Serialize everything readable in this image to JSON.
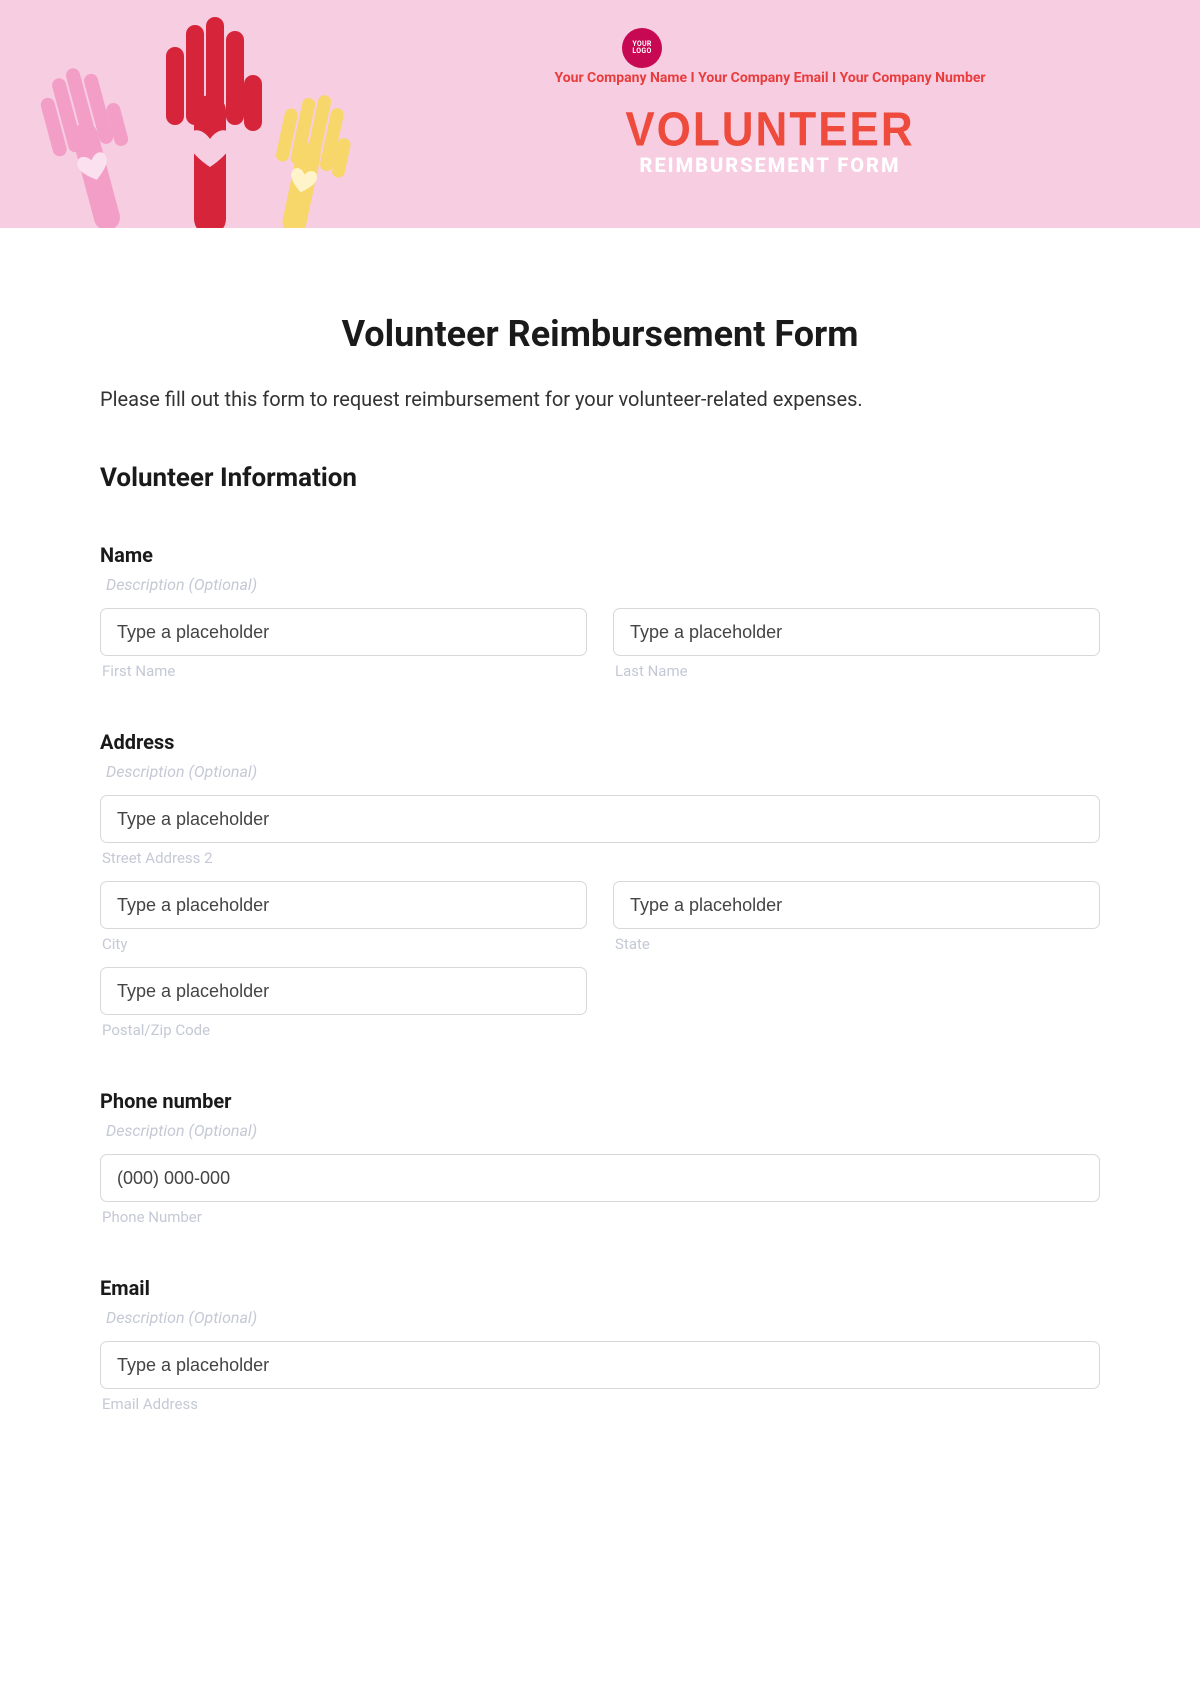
{
  "banner": {
    "logo_text": "YOUR LOGO",
    "company_name": "Your Company Name",
    "company_email": "Your Company Email",
    "company_number": "Your Company Number",
    "sep": "  I  ",
    "title_main": "VOLUNTEER",
    "title_sub": "REIMBURSEMENT FORM"
  },
  "form": {
    "title": "Volunteer Reimbursement Form",
    "intro": "Please fill out this form to request reimbursement for your volunteer-related expenses.",
    "section_volunteer": "Volunteer Information",
    "desc_optional": "Description (Optional)",
    "placeholder_generic": "Type a placeholder",
    "name": {
      "label": "Name",
      "first_sub": "First Name",
      "last_sub": "Last Name"
    },
    "address": {
      "label": "Address",
      "street2_sub": "Street Address 2",
      "city_sub": "City",
      "state_sub": "State",
      "postal_sub": "Postal/Zip Code"
    },
    "phone": {
      "label": "Phone number",
      "placeholder": "(000) 000-000",
      "sub": "Phone Number"
    },
    "email": {
      "label": "Email",
      "sub": "Email Address"
    }
  }
}
